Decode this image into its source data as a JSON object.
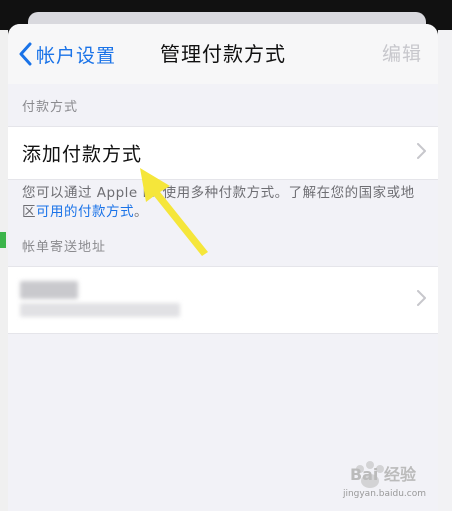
{
  "navbar": {
    "back_label": "帐户设置",
    "title": "管理付款方式",
    "edit_label": "编辑"
  },
  "payment_section": {
    "header": "付款方式",
    "add_row_label": "添加付款方式",
    "footnote_prefix": "您可以通过 Apple ID 使用多种付款方式。了解在您的国家或地区",
    "footnote_link": "可用的付款方式",
    "footnote_suffix": "。"
  },
  "billing_section": {
    "header": "帐单寄送地址"
  },
  "icons": {
    "back": "chevron-left-icon",
    "row_chevron": "chevron-right-icon",
    "annotation": "yellow-arrow-icon"
  },
  "colors": {
    "accent": "#1a73e8",
    "edit_disabled": "#c7c7cc",
    "background": "#f2f2f7",
    "annotation_arrow": "#f5e63a"
  },
  "watermark": {
    "text": "Bai 经验",
    "url_text": "jingyan.baidu.com"
  }
}
